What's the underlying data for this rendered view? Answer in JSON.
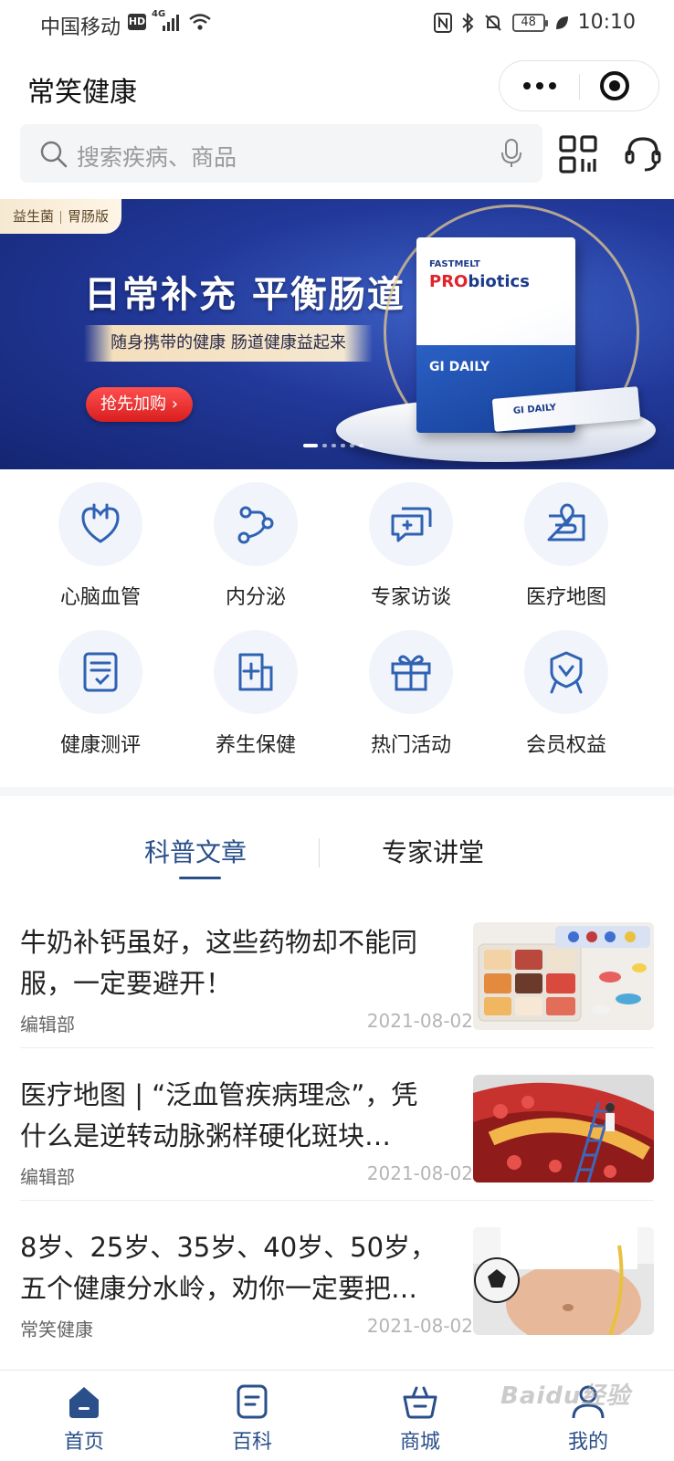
{
  "status_bar": {
    "carrier": "中国移动",
    "hd_badge": "HD",
    "network": "4G",
    "battery": "48",
    "time": "10:10"
  },
  "header": {
    "title": "常笑健康"
  },
  "search": {
    "placeholder": "搜索疾病、商品"
  },
  "banner": {
    "tag_left": "益生菌",
    "tag_right": "胃肠版",
    "headline": "日常补充 平衡肠道",
    "subline": "随身携带的健康 肠道健康益起来",
    "cta": "抢先加购 ›",
    "product_brand": "FASTMELT",
    "product_name_pro": "PRO",
    "product_name_rest": "biotics",
    "product_line": "GI DAILY",
    "sachet_label": "GI DAILY",
    "slide_count": 6,
    "active_slide": 0
  },
  "categories": [
    {
      "label": "心脑血管",
      "icon": "heart-icon"
    },
    {
      "label": "内分泌",
      "icon": "share-nodes-icon"
    },
    {
      "label": "专家访谈",
      "icon": "chat-plus-icon"
    },
    {
      "label": "医疗地图",
      "icon": "map-pin-icon"
    },
    {
      "label": "健康测评",
      "icon": "clipboard-check-icon"
    },
    {
      "label": "养生保健",
      "icon": "medical-box-icon"
    },
    {
      "label": "热门活动",
      "icon": "gift-icon"
    },
    {
      "label": "会员权益",
      "icon": "badge-icon"
    }
  ],
  "tabs": [
    {
      "label": "科普文章",
      "active": true
    },
    {
      "label": "专家讲堂",
      "active": false
    }
  ],
  "articles": [
    {
      "title": "牛奶补钙虽好，这些药物却不能同服，一定要避开！",
      "source": "编辑部",
      "date": "2021-08-02"
    },
    {
      "title": "医疗地图 | “泛血管疾病理念”，凭什么是逆转动脉粥样硬化斑块…",
      "source": "编辑部",
      "date": "2021-08-02"
    },
    {
      "title": "8岁、25岁、35岁、40岁、50岁，五个健康分水岭，劝你一定要把…",
      "source": "常笑健康",
      "date": "2021-08-02"
    }
  ],
  "bottom_nav": [
    {
      "label": "首页",
      "icon": "home-icon",
      "active": true
    },
    {
      "label": "百科",
      "icon": "book-icon",
      "active": false
    },
    {
      "label": "商城",
      "icon": "basket-icon",
      "active": false
    },
    {
      "label": "我的",
      "icon": "user-icon",
      "active": false
    }
  ],
  "watermark": "Baidu经验",
  "colors": {
    "accent": "#2a4f8a",
    "icon_blue": "#2f62b3",
    "banner_bg": "#22399a",
    "cta_red": "#e0242c"
  }
}
